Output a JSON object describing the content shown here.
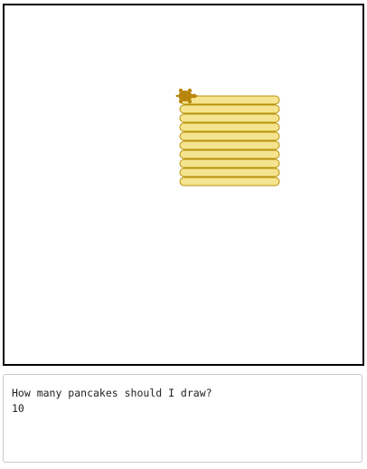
{
  "turtle_canvas": {
    "pancake_count": 10,
    "pancake_fill": "#f4e48f",
    "pancake_stroke": "#b8900a",
    "turtle_color": "#b8860b",
    "turtle_icon": "turtle-icon",
    "border_color": "#000000"
  },
  "console": {
    "prompt": "How many pancakes should I draw?",
    "input_value": "10"
  }
}
